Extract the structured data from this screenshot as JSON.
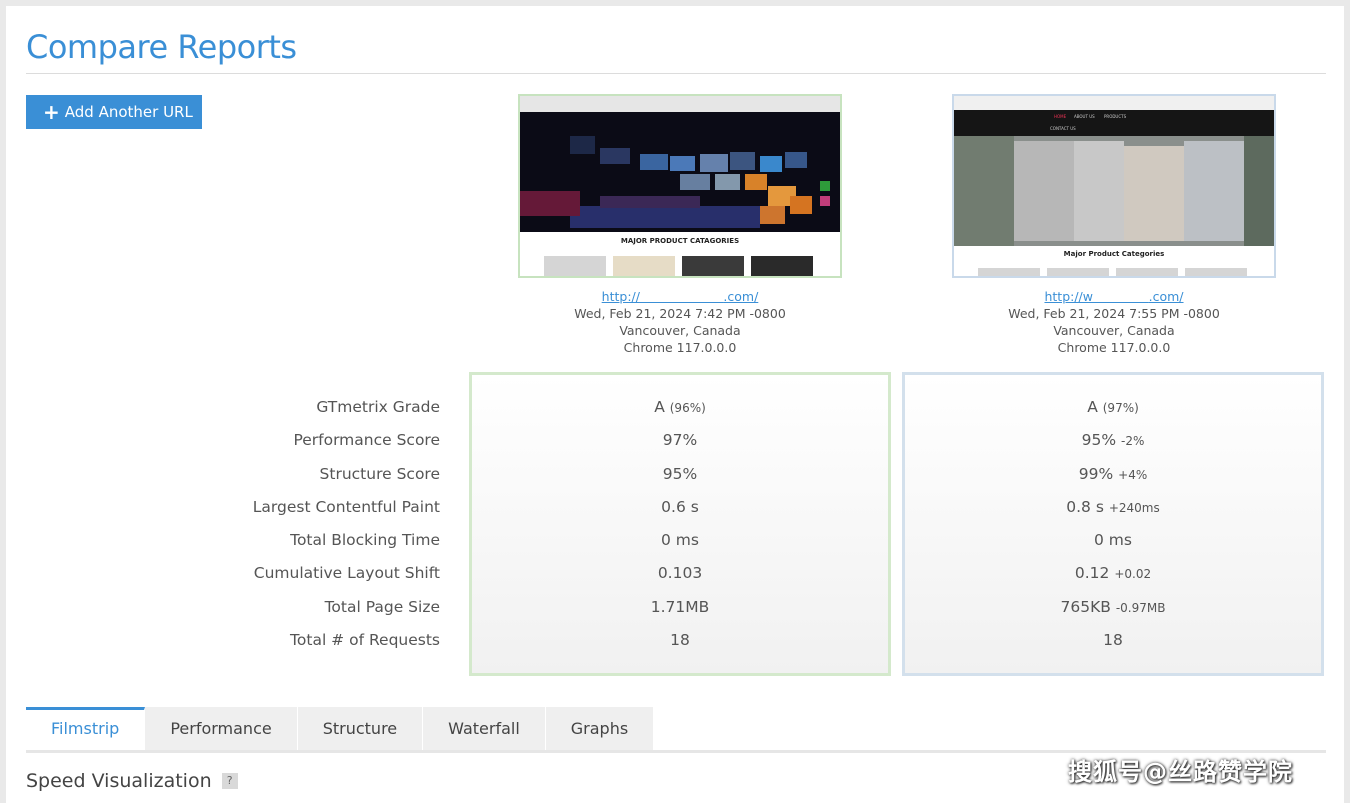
{
  "page": {
    "title": "Compare Reports"
  },
  "toolbar": {
    "add_label": "Add Another URL",
    "add_icon": "plus-icon"
  },
  "reports": [
    {
      "url": "http://",
      "url_end": ".com/",
      "date": "Wed, Feb 21, 2024 7:42 PM -0800",
      "location": "Vancouver, Canada",
      "browser": "Chrome 117.0.0.0",
      "thumb_heading": "MAJOR PRODUCT CATAGORIES",
      "accent": "#c7e3bf"
    },
    {
      "url": "http://w",
      "url_end": ".com/",
      "date": "Wed, Feb 21, 2024 7:55 PM -0800",
      "location": "Vancouver, Canada",
      "browser": "Chrome 117.0.0.0",
      "thumb_heading": "Major Product Categories",
      "thumb_nav": [
        "HOME",
        "ABOUT US",
        "PRODUCTS",
        "CONTACT US"
      ],
      "accent": "#c9d9ea"
    }
  ],
  "metrics": {
    "labels": [
      "GTmetrix Grade",
      "Performance Score",
      "Structure Score",
      "Largest Contentful Paint",
      "Total Blocking Time",
      "Cumulative Layout Shift",
      "Total Page Size",
      "Total # of Requests"
    ],
    "report1": [
      {
        "value": "A",
        "extra": "(96%)",
        "color": "neutral"
      },
      {
        "value": "97%",
        "extra": "",
        "color": "good"
      },
      {
        "value": "95%",
        "extra": "",
        "color": "bad"
      },
      {
        "value": "0.6 s",
        "extra": "",
        "color": "good"
      },
      {
        "value": "0 ms",
        "extra": "",
        "color": "neutral"
      },
      {
        "value": "0.103",
        "extra": "",
        "color": "good"
      },
      {
        "value": "1.71MB",
        "extra": "",
        "color": "bad"
      },
      {
        "value": "18",
        "extra": "",
        "color": "neutral"
      }
    ],
    "report2": [
      {
        "value": "A",
        "extra": "(97%)",
        "color": "neutral"
      },
      {
        "value": "95%",
        "extra": "-2%",
        "color": "bad"
      },
      {
        "value": "99%",
        "extra": "+4%",
        "color": "good"
      },
      {
        "value": "0.8 s",
        "extra": "+240ms",
        "color": "bad"
      },
      {
        "value": "0 ms",
        "extra": "",
        "color": "neutral"
      },
      {
        "value": "0.12",
        "extra": "+0.02",
        "color": "bad"
      },
      {
        "value": "765KB",
        "extra": "-0.97MB",
        "color": "good"
      },
      {
        "value": "18",
        "extra": "",
        "color": "neutral"
      }
    ]
  },
  "tabs": [
    {
      "label": "Filmstrip",
      "active": true
    },
    {
      "label": "Performance",
      "active": false
    },
    {
      "label": "Structure",
      "active": false
    },
    {
      "label": "Waterfall",
      "active": false
    },
    {
      "label": "Graphs",
      "active": false
    }
  ],
  "section": {
    "title": "Speed Visualization",
    "help": "?"
  },
  "watermark": "搜狐号@丝路赞学院",
  "colors": {
    "accent": "#3a8fd6",
    "good": "#46b536",
    "bad": "#c0262d",
    "neutral": "#555555"
  }
}
